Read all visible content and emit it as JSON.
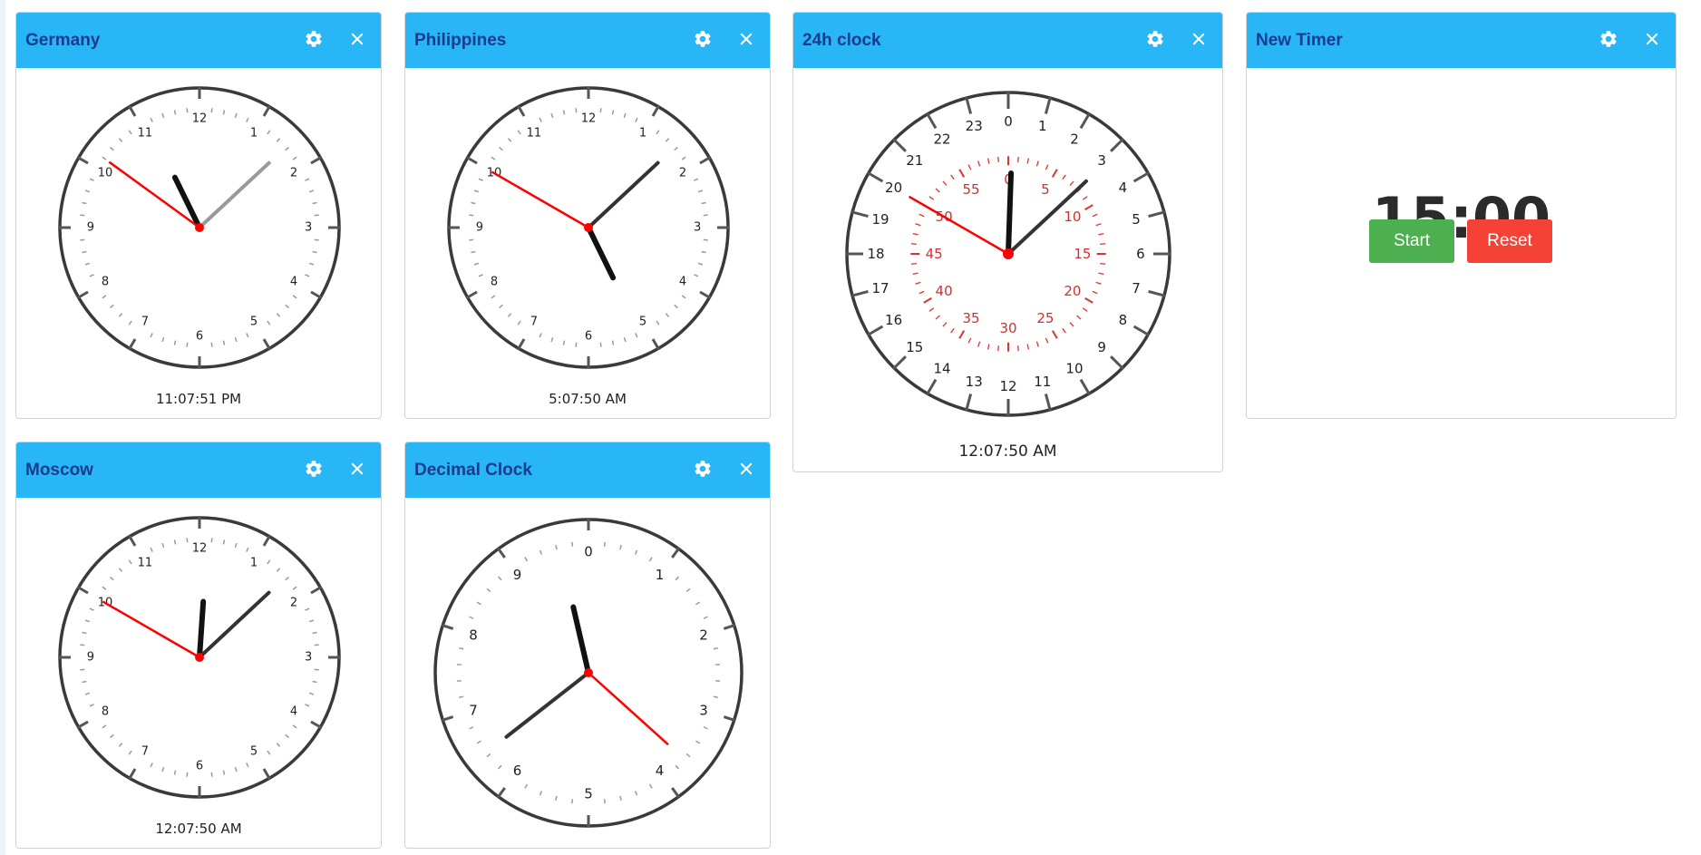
{
  "colors": {
    "header": "#29b6f6",
    "title_text": "#1a3c8f",
    "second_hand": "#ff0000",
    "start_button": "#4caf50",
    "reset_button": "#f44336"
  },
  "icons": {
    "settings": "gear-icon",
    "close": "close-icon"
  },
  "widgets": {
    "germany": {
      "title": "Germany",
      "time": "11:07:51 PM",
      "dial_numbers": [
        "12",
        "1",
        "2",
        "3",
        "4",
        "5",
        "6",
        "7",
        "8",
        "9",
        "10",
        "11"
      ],
      "hand_angles_deg": {
        "hour": 333.9,
        "minute": 47.1,
        "second": 306
      },
      "minute_hand_color": "#999999"
    },
    "philippines": {
      "title": "Philippines",
      "time": "5:07:50 AM",
      "dial_numbers": [
        "12",
        "1",
        "2",
        "3",
        "4",
        "5",
        "6",
        "7",
        "8",
        "9",
        "10",
        "11"
      ],
      "hand_angles_deg": {
        "hour": 153.9,
        "minute": 47,
        "second": 300
      }
    },
    "clock24": {
      "title": "24h clock",
      "time": "12:07:50 AM",
      "hour_numbers": [
        "0",
        "1",
        "2",
        "3",
        "4",
        "5",
        "6",
        "7",
        "8",
        "9",
        "10",
        "11",
        "12",
        "13",
        "14",
        "15",
        "16",
        "17",
        "18",
        "19",
        "20",
        "21",
        "22",
        "23"
      ],
      "minute_numbers": [
        "0",
        "5",
        "10",
        "15",
        "20",
        "25",
        "30",
        "35",
        "40",
        "45",
        "50",
        "55"
      ],
      "hand_angles_deg": {
        "hour": 1.96,
        "minute": 47,
        "second": 300
      }
    },
    "timer": {
      "title": "New Timer",
      "display": "15:00",
      "start_label": "Start",
      "reset_label": "Reset"
    },
    "moscow": {
      "title": "Moscow",
      "time": "12:07:50 AM",
      "dial_numbers": [
        "12",
        "1",
        "2",
        "3",
        "4",
        "5",
        "6",
        "7",
        "8",
        "9",
        "10",
        "11"
      ],
      "hand_angles_deg": {
        "hour": 3.9,
        "minute": 47,
        "second": 300
      }
    },
    "decimal": {
      "title": "Decimal Clock",
      "dial_numbers": [
        "0",
        "1",
        "2",
        "3",
        "4",
        "5",
        "6",
        "7",
        "8",
        "9"
      ],
      "hand_angles_deg": {
        "hour": 347,
        "minute": 232,
        "second": 132
      }
    }
  }
}
